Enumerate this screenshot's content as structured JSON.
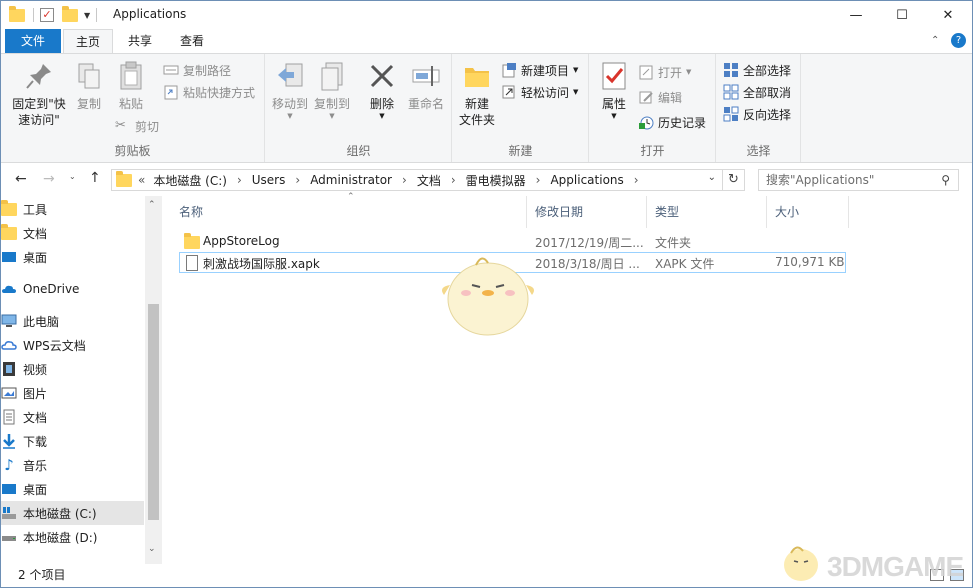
{
  "window": {
    "title": "Applications",
    "controls": {
      "minimize": "—",
      "maximize": "☐",
      "close": "✕"
    }
  },
  "ribbon_tabs": [
    "文件",
    "主页",
    "共享",
    "查看"
  ],
  "ribbon": {
    "clipboard": {
      "label": "剪贴板",
      "pin": "固定到\"快\n速访问\"",
      "copy": "复制",
      "paste": "粘贴",
      "copy_path": "复制路径",
      "paste_shortcut": "粘贴快捷方式",
      "cut": "剪切"
    },
    "organize": {
      "label": "组织",
      "move_to": "移动到",
      "copy_to": "复制到",
      "delete": "删除",
      "rename": "重命名"
    },
    "new": {
      "label": "新建",
      "new_folder": "新建\n文件夹",
      "new_item": "新建项目",
      "easy_access": "轻松访问"
    },
    "open": {
      "label": "打开",
      "properties": "属性",
      "open": "打开",
      "edit": "编辑",
      "history": "历史记录"
    },
    "select": {
      "label": "选择",
      "select_all": "全部选择",
      "select_none": "全部取消",
      "invert": "反向选择"
    }
  },
  "address": {
    "prefix": "«",
    "segments": [
      "本地磁盘 (C:)",
      "Users",
      "Administrator",
      "文档",
      "雷电模拟器",
      "Applications"
    ],
    "separator": "›"
  },
  "search": {
    "placeholder": "搜索\"Applications\""
  },
  "sidebar": [
    {
      "label": "工具",
      "icon": "folder-icon"
    },
    {
      "label": "文档",
      "icon": "folder-icon"
    },
    {
      "label": "桌面",
      "icon": "desktop-icon"
    },
    {
      "label": "OneDrive",
      "icon": "cloud-icon"
    },
    {
      "label": "此电脑",
      "icon": "computer-icon"
    },
    {
      "label": "WPS云文档",
      "icon": "wps-cloud-icon"
    },
    {
      "label": "视频",
      "icon": "video-icon"
    },
    {
      "label": "图片",
      "icon": "picture-icon"
    },
    {
      "label": "文档",
      "icon": "document-icon"
    },
    {
      "label": "下载",
      "icon": "download-icon"
    },
    {
      "label": "音乐",
      "icon": "music-icon"
    },
    {
      "label": "桌面",
      "icon": "desktop-icon"
    },
    {
      "label": "本地磁盘 (C:)",
      "icon": "drive-icon",
      "selected": true
    },
    {
      "label": "本地磁盘 (D:)",
      "icon": "drive-icon"
    }
  ],
  "columns": [
    "名称",
    "修改日期",
    "类型",
    "大小"
  ],
  "files": [
    {
      "name": "AppStoreLog",
      "date": "2017/12/19/周二...",
      "type": "文件夹",
      "size": "",
      "icon": "folder-icon"
    },
    {
      "name": "刺激战场国际服.xapk",
      "date": "2018/3/18/周日 ...",
      "type": "XAPK 文件",
      "size": "710,971 KB",
      "icon": "file-icon"
    }
  ],
  "status": {
    "count": "2 个项目"
  },
  "watermark": {
    "text": "3DMGAME"
  },
  "colors": {
    "accent": "#1979ca",
    "ribbon_bg": "#f5f6f7",
    "selection": "#99d1ff"
  }
}
